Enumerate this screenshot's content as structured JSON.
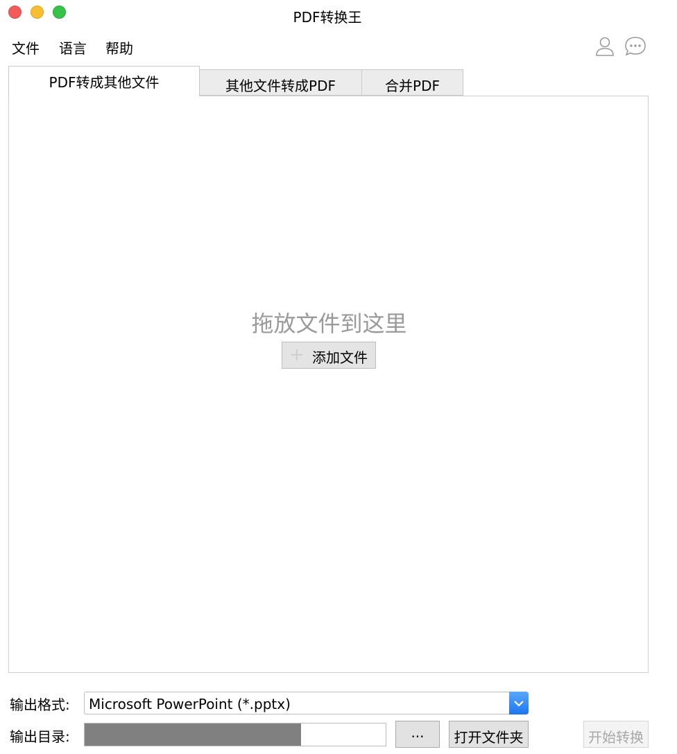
{
  "window": {
    "title": "PDF转换王"
  },
  "menu": {
    "file": "文件",
    "language": "语言",
    "help": "帮助"
  },
  "icons": {
    "user": "user-icon",
    "chat": "chat-icon"
  },
  "tabs": [
    {
      "label": "PDF转成其他文件",
      "active": true
    },
    {
      "label": "其他文件转成PDF",
      "active": false
    },
    {
      "label": "合并PDF",
      "active": false
    }
  ],
  "dropzone": {
    "hint": "拖放文件到这里",
    "add_button": "添加文件"
  },
  "output": {
    "format_label": "输出格式:",
    "format_value": "Microsoft PowerPoint (*.pptx)",
    "dir_label": "输出目录:",
    "dir_fill_fraction": 0.72,
    "browse_label": "...",
    "open_folder_label": "打开文件夹",
    "start_label": "开始转换"
  },
  "colors": {
    "close": "#f15b5a",
    "minimize": "#f7bd33",
    "maximize": "#37c24a",
    "select_arrow": "#2f86f5",
    "dir_fill": "#808080"
  }
}
